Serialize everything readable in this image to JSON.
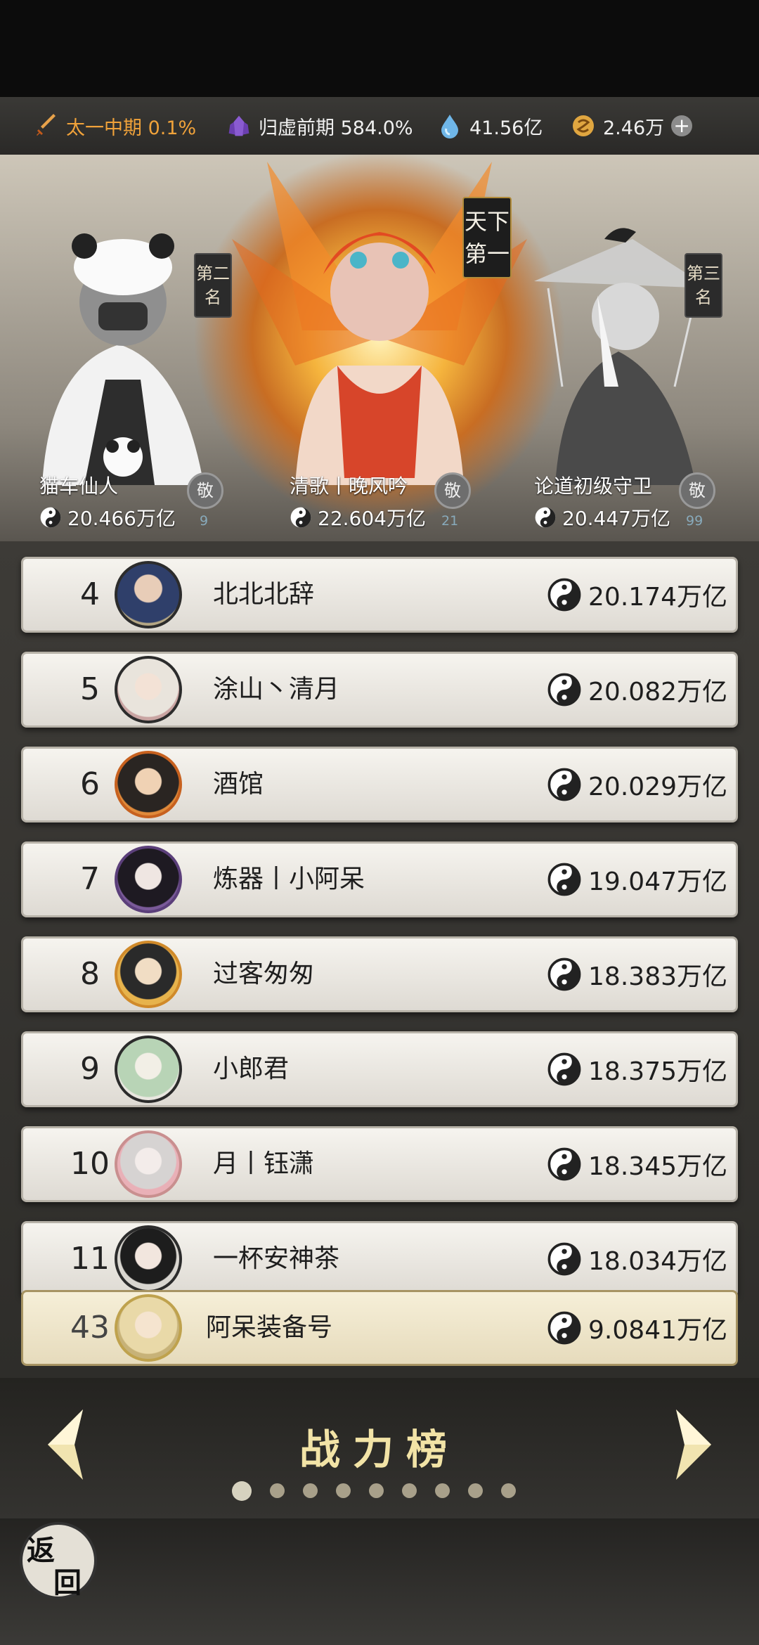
{
  "resources": [
    {
      "icon": "sword-icon",
      "label": "太一中期 0.1%",
      "color": "#f0a23a"
    },
    {
      "icon": "crystal-icon",
      "label": "归虚前期 584.0%",
      "color": "#ffffff"
    },
    {
      "icon": "water-drop-icon",
      "label": "41.56亿",
      "color": "#ffffff"
    },
    {
      "icon": "spirit-coin-icon",
      "label": "2.46万",
      "color": "#ffffff"
    }
  ],
  "podium": {
    "first": {
      "plaque": "天下第一",
      "name": "清歌丨晚风吟",
      "power": "22.604万亿",
      "worship_label": "敬",
      "worship_count": "21"
    },
    "second": {
      "plaque": "第二名",
      "name": "猫车仙人",
      "power": "20.466万亿",
      "worship_label": "敬",
      "worship_count": "9"
    },
    "third": {
      "plaque": "第三名",
      "name": "论道初级守卫",
      "power": "20.447万亿",
      "worship_label": "敬",
      "worship_count": "99"
    }
  },
  "rankings": [
    {
      "rank": "4",
      "name": "北北北辞",
      "power": "20.174万亿"
    },
    {
      "rank": "5",
      "name": "涂山丶清月",
      "power": "20.082万亿"
    },
    {
      "rank": "6",
      "name": "酒馆",
      "power": "20.029万亿"
    },
    {
      "rank": "7",
      "name": "炼器丨小阿呆",
      "power": "19.047万亿"
    },
    {
      "rank": "8",
      "name": "过客匆匆",
      "power": "18.383万亿"
    },
    {
      "rank": "9",
      "name": "小郎君",
      "power": "18.375万亿"
    },
    {
      "rank": "10",
      "name": "月丨钰潇",
      "power": "18.345万亿"
    },
    {
      "rank": "11",
      "name": "一杯安神茶",
      "power": "18.034万亿"
    }
  ],
  "self": {
    "rank": "43",
    "name": "阿呆装备号",
    "power": "9.0841万亿"
  },
  "board": {
    "title": "战力榜",
    "page_count": 9,
    "current_page": 1
  },
  "back": {
    "line1": "返",
    "line2": "回"
  }
}
